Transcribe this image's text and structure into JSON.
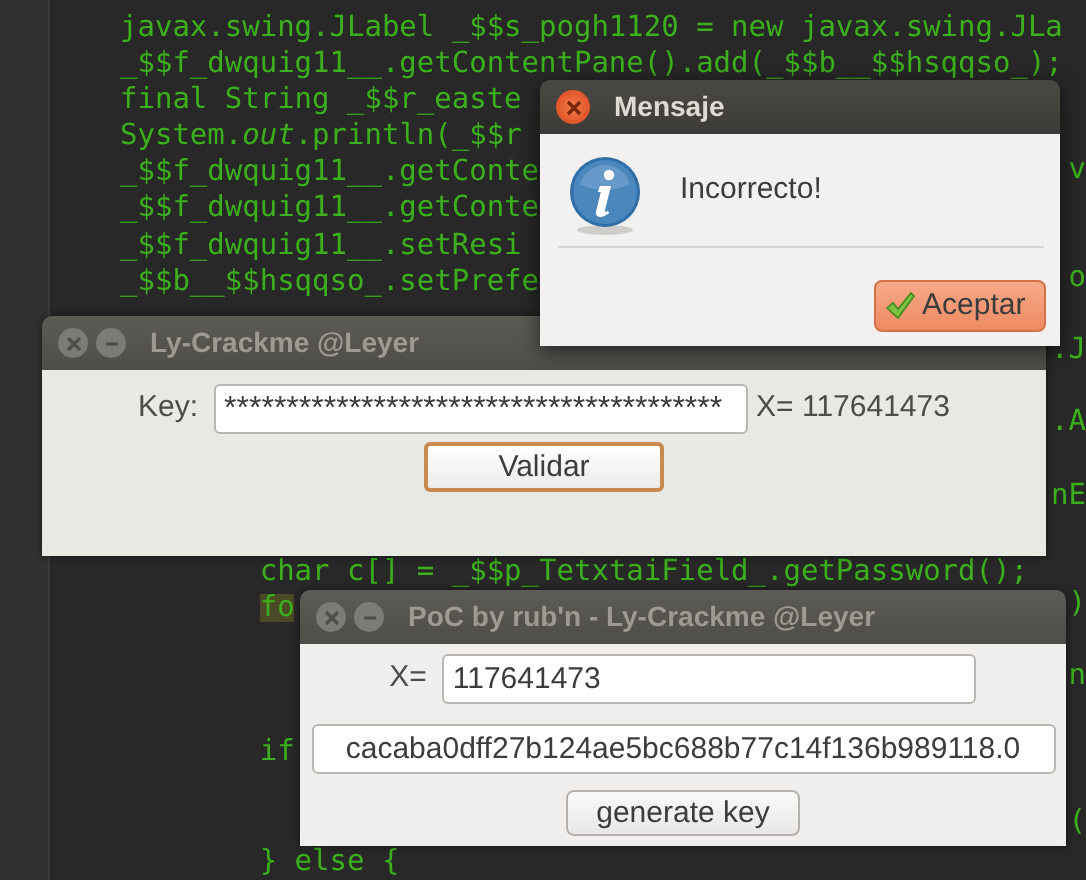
{
  "editor": {
    "lines": [
      {
        "kind": "code",
        "text": "javax.swing.JLabel _$$s_pogh1120 = new javax.swing.JLa"
      },
      {
        "kind": "code",
        "text": "_$$f_dwquig11__.getContentPane().add(_$$b__$$hsqqso_);"
      },
      {
        "kind": "code",
        "text": "final String _$$r_easte"
      },
      {
        "kind": "code",
        "text": "System.*out*.println(_$$r"
      },
      {
        "kind": "code",
        "text": "_$$f_dwquig11__.getConte",
        "right": "v"
      },
      {
        "kind": "code",
        "text": "_$$f_dwquig11__.getConte"
      },
      {
        "kind": "code",
        "text": "_$$f_dwquig11__.setResi"
      },
      {
        "kind": "code",
        "text": "_$$b__$$hsqqso_.setPrefe",
        "right": "o"
      },
      {
        "kind": "blank"
      },
      {
        "kind": "code",
        "right": ".J"
      },
      {
        "kind": "blank"
      },
      {
        "kind": "code",
        "right": ".A"
      },
      {
        "kind": "blank"
      },
      {
        "kind": "code",
        "right": "nE"
      },
      {
        "kind": "blank"
      },
      {
        "kind": "code",
        "text": "        char c[] = _$$p_TetxtaiField_.getPassword();"
      },
      {
        "kind": "code",
        "text": "        fo",
        "highlighted": true,
        "right": ")"
      },
      {
        "kind": "blank"
      },
      {
        "kind": "code",
        "right": "n"
      },
      {
        "kind": "blank"
      },
      {
        "kind": "code",
        "text": "        if"
      },
      {
        "kind": "blank"
      },
      {
        "kind": "code",
        "right": "("
      },
      {
        "kind": "code",
        "text": "        } else {"
      }
    ]
  },
  "crackme_window": {
    "title": "Ly-Crackme @Leyer",
    "active": false,
    "key_label": "Key:",
    "key_value": "****************************************",
    "x_text": "X= 117641473",
    "button": "Validar"
  },
  "poc_window": {
    "title": "PoC by rub'n - Ly-Crackme @Leyer",
    "active": false,
    "x_label": "X=",
    "x_value": "117641473",
    "key_value": "cacaba0dff27b124ae5bc688b77c14f136b989118.0",
    "button": "generate key"
  },
  "message_dialog": {
    "title": "Mensaje",
    "active": true,
    "message": "Incorrecto!",
    "button": "Aceptar"
  }
}
